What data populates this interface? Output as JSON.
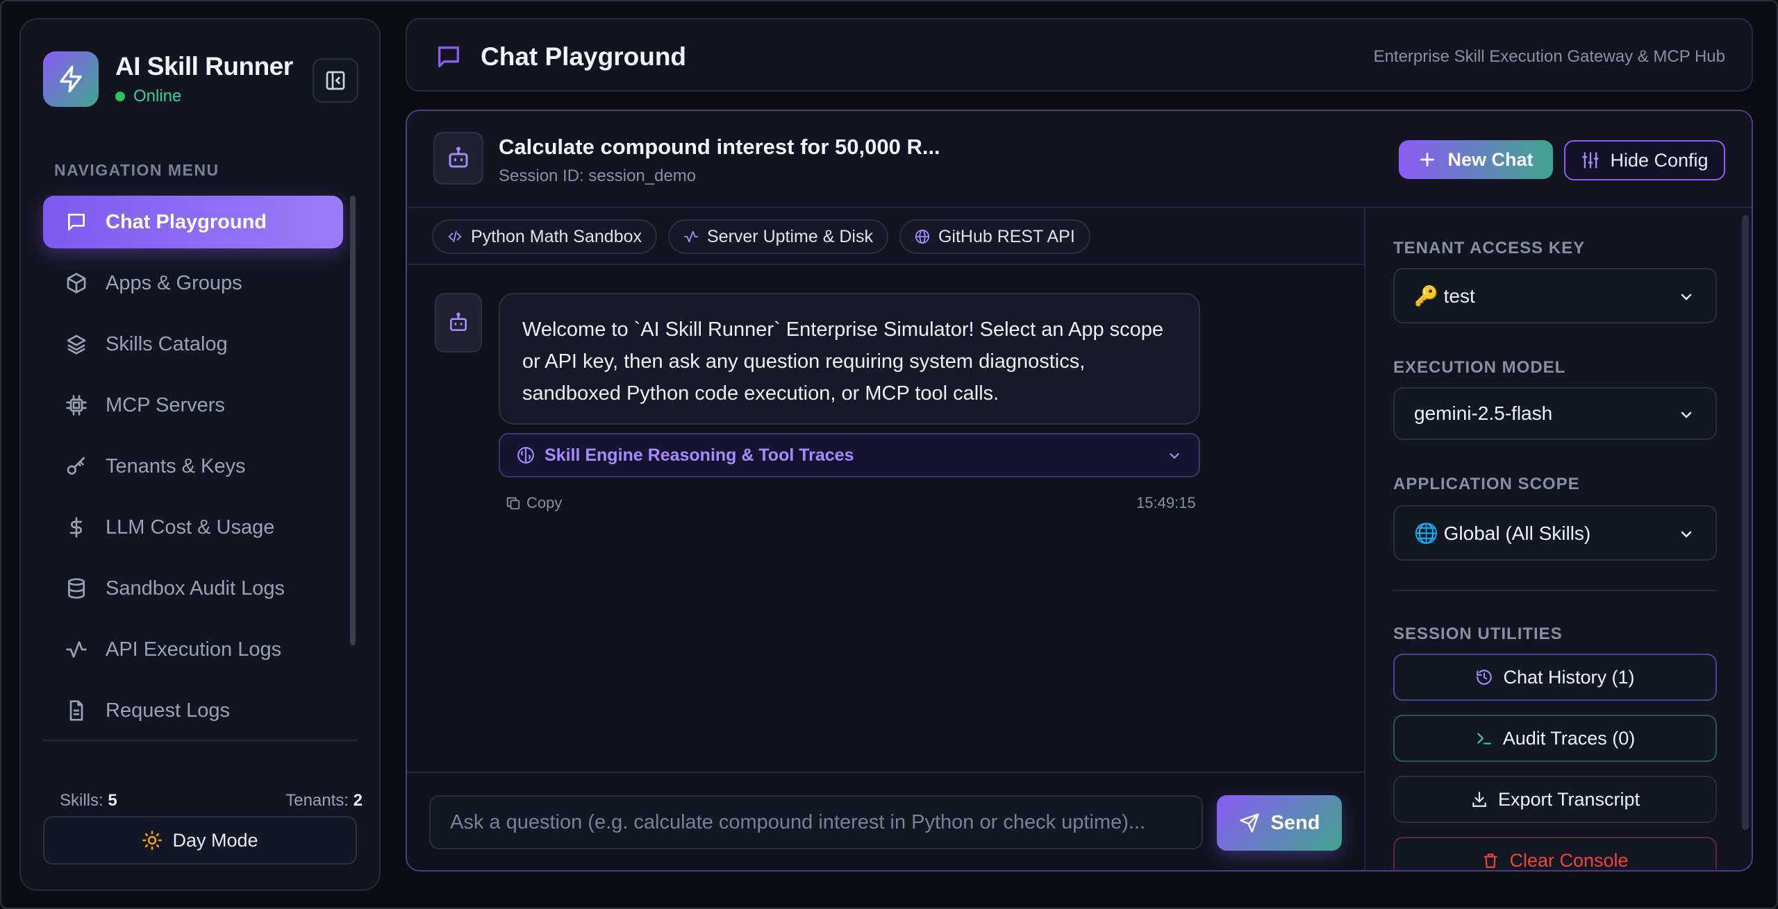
{
  "app": {
    "name": "AI Skill Runner",
    "status": "Online"
  },
  "sidebar": {
    "nav_heading": "NAVIGATION MENU",
    "items": [
      {
        "label": "Chat Playground",
        "icon": "chat-bubble-icon",
        "active": true
      },
      {
        "label": "Apps & Groups",
        "icon": "cube-icon"
      },
      {
        "label": "Skills Catalog",
        "icon": "layers-icon"
      },
      {
        "label": "MCP Servers",
        "icon": "cpu-chip-icon"
      },
      {
        "label": "Tenants & Keys",
        "icon": "key-icon"
      },
      {
        "label": "LLM Cost & Usage",
        "icon": "dollar-icon"
      },
      {
        "label": "Sandbox Audit Logs",
        "icon": "database-icon"
      },
      {
        "label": "API Execution Logs",
        "icon": "activity-icon"
      },
      {
        "label": "Request Logs",
        "icon": "document-icon"
      }
    ],
    "skills_label": "Skills:",
    "skills_count": "5",
    "tenants_label": "Tenants:",
    "tenants_count": "2",
    "day_mode_label": "Day Mode"
  },
  "header": {
    "title": "Chat Playground",
    "subtitle": "Enterprise Skill Execution Gateway & MCP Hub"
  },
  "session": {
    "title": "Calculate compound interest for 50,000 R...",
    "id_text": "Session ID: session_demo",
    "new_chat_label": "New Chat",
    "hide_config_label": "Hide Config"
  },
  "skill_chips": [
    {
      "label": "Python Math Sandbox",
      "icon": "code-icon"
    },
    {
      "label": "Server Uptime & Disk",
      "icon": "activity-icon"
    },
    {
      "label": "GitHub REST API",
      "icon": "globe-icon"
    }
  ],
  "message": {
    "text": "Welcome to `AI Skill Runner` Enterprise Simulator! Select an App scope or API key, then ask any question requiring system diagnostics, sandboxed Python code execution, or MCP tool calls.",
    "trace_label": "Skill Engine Reasoning & Tool Traces",
    "copy_label": "Copy",
    "timestamp": "15:49:15"
  },
  "composer": {
    "placeholder": "Ask a question (e.g. calculate compound interest in Python or check uptime)...",
    "value": "",
    "send_label": "Send"
  },
  "config": {
    "tenant_label": "TENANT ACCESS KEY",
    "tenant_value": "🔑 test",
    "model_label": "EXECUTION MODEL",
    "model_value": "gemini-2.5-flash",
    "scope_label": "APPLICATION SCOPE",
    "scope_value": "🌐 Global (All Skills)",
    "utilities_label": "SESSION UTILITIES",
    "history_label": "Chat History (1)",
    "audit_label": "Audit Traces (0)",
    "export_label": "Export Transcript",
    "clear_label": "Clear Console"
  },
  "colors": {
    "accent_purple": "#8b5cf6",
    "accent_green": "#3fa58c",
    "online_green": "#22c55e",
    "danger_red": "#ef4444"
  }
}
